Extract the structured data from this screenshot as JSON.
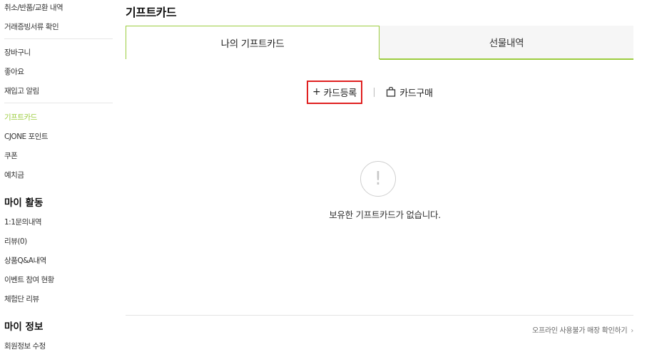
{
  "sidebar": {
    "top_items": [
      {
        "label": "취소/반품/교환 내역"
      },
      {
        "label": "거래증빙서류 확인"
      }
    ],
    "benefit_items": [
      {
        "label": "장바구니"
      },
      {
        "label": "좋아요"
      },
      {
        "label": "재입고 알림"
      }
    ],
    "wallet_items": [
      {
        "label": "기프트카드",
        "active": true
      },
      {
        "label": "CJONE 포인트"
      },
      {
        "label": "쿠폰"
      },
      {
        "label": "예치금"
      }
    ],
    "activity": {
      "heading": "마이 활동",
      "items": [
        {
          "label": "1:1문의내역"
        },
        {
          "label": "리뷰(0)"
        },
        {
          "label": "상품Q&A내역"
        },
        {
          "label": "이벤트 참여 현황"
        },
        {
          "label": "체험단 리뷰"
        }
      ]
    },
    "info": {
      "heading": "마이 정보",
      "items": [
        {
          "label": "회원정보 수정"
        }
      ]
    },
    "active_color": "#9ccc3f"
  },
  "main": {
    "title": "기프트카드",
    "tabs": [
      {
        "label": "나의 기프트카드",
        "active": true
      },
      {
        "label": "선물내역",
        "active": false
      }
    ],
    "actions": {
      "register_prefix": "+",
      "register_label": "카드등록",
      "buy_label": "카드구매",
      "buy_icon": "shopping-bag-icon"
    },
    "empty_state": {
      "icon": "exclamation-circle-icon",
      "icon_text": "!",
      "message": "보유한 기프트카드가 없습니다."
    },
    "footer_link": {
      "label": "오프라인 사용불가 매장 확인하기",
      "chevron": "›"
    }
  },
  "colors": {
    "accent": "#9ccc3f",
    "highlight_border": "#e02020"
  }
}
